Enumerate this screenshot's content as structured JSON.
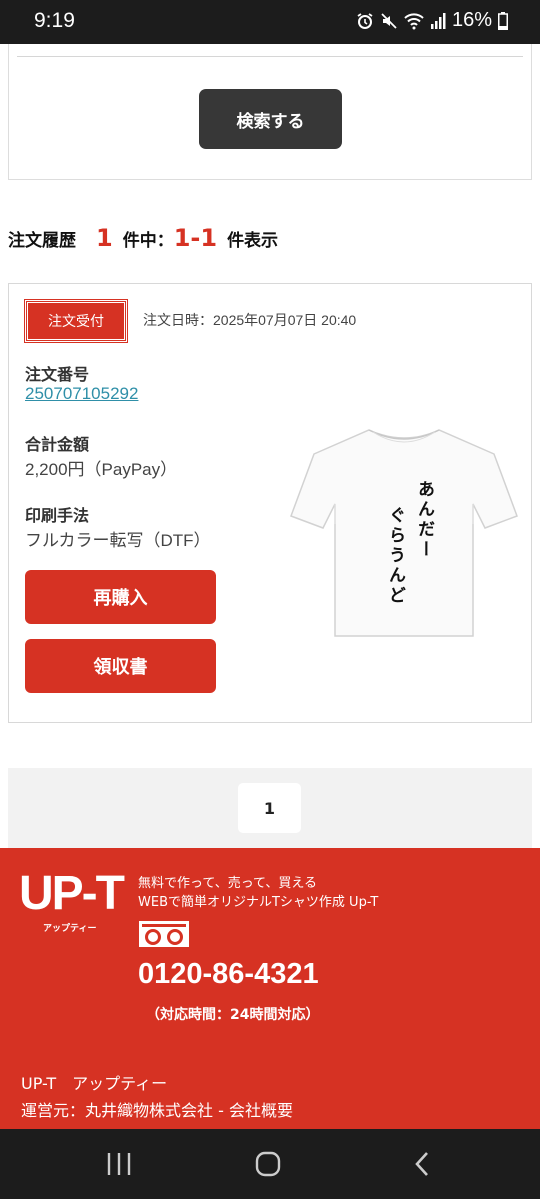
{
  "status_bar": {
    "time": "9:19",
    "battery": "16%",
    "icons": [
      "alarm-icon",
      "mute-icon",
      "wifi-icon",
      "signal-icon",
      "battery-icon"
    ]
  },
  "search": {
    "button_label": "検索する"
  },
  "history": {
    "title": "注文履歴",
    "total": "1",
    "total_suffix": "件中：",
    "range": "1-1",
    "range_suffix": "件表示"
  },
  "order": {
    "status_badge": "注文受付",
    "date_label": "注文日時：",
    "date_value": "2025年07月07日 20:40",
    "number_label": "注文番号",
    "number_value": "250707105292",
    "total_label": "合計金額",
    "total_value": "2,200円（PayPay）",
    "method_label": "印刷手法",
    "method_value": "フルカラー転写（DTF）",
    "rebuy_button": "再購入",
    "receipt_button": "領収書",
    "shirt_text_line1": "あんだー",
    "shirt_text_line2": "ぐらうんど"
  },
  "pagination": {
    "current_page": "1"
  },
  "footer": {
    "logo": "UP-T",
    "logo_sub": "アップティー",
    "tagline_1": "無料で作って、売って、買える",
    "tagline_2": "WEBで簡単オリジナルTシャツ作成 Up-T",
    "freedial_icon": "freedial-icon",
    "phone": "0120-86-4321",
    "hours": "（対応時間：24時間対応）",
    "brand_line": "UP-T　アップティー",
    "operator_line": "運営元：丸井織物株式会社 - 会社概要"
  },
  "nav_bar": {
    "icons": [
      "recent-apps-icon",
      "home-icon",
      "back-icon"
    ]
  },
  "colors": {
    "brand_red": "#d63223",
    "dark_button": "#373737",
    "link": "#2f8fa8",
    "system_bar": "#1c1c1c"
  }
}
